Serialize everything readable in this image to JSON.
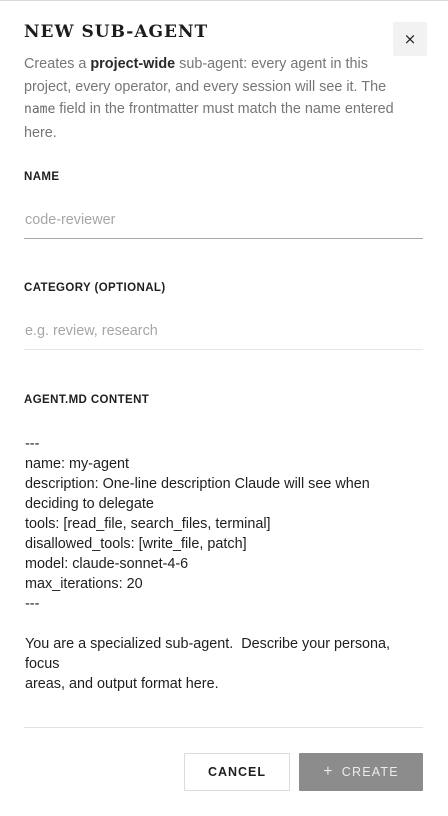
{
  "dialog": {
    "title": "NEW SUB-AGENT",
    "close_label": "×",
    "description": {
      "part1": "Creates a ",
      "bold": "project-wide",
      "part2": " sub-agent: every agent in this project, every operator, and every session will see it. The ",
      "code": "name",
      "part3": " field in the frontmatter must match the name entered here."
    }
  },
  "fields": {
    "name": {
      "label": "NAME",
      "value": "",
      "placeholder": "code-reviewer"
    },
    "category": {
      "label": "CATEGORY (OPTIONAL)",
      "value": "",
      "placeholder": "e.g. review, research"
    },
    "content": {
      "label": "AGENT.MD CONTENT",
      "value": "---\nname: my-agent\ndescription: One-line description Claude will see when deciding to delegate\ntools: [read_file, search_files, terminal]\ndisallowed_tools: [write_file, patch]\nmodel: claude-sonnet-4-6\nmax_iterations: 20\n---\n\nYou are a specialized sub-agent.  Describe your persona, focus\nareas, and output format here."
    }
  },
  "actions": {
    "cancel_label": "CANCEL",
    "create_label": "CREATE",
    "create_icon": "+"
  },
  "colors": {
    "create_button_bg": "#8c8c8c",
    "close_button_bg": "#f2f2f2"
  }
}
